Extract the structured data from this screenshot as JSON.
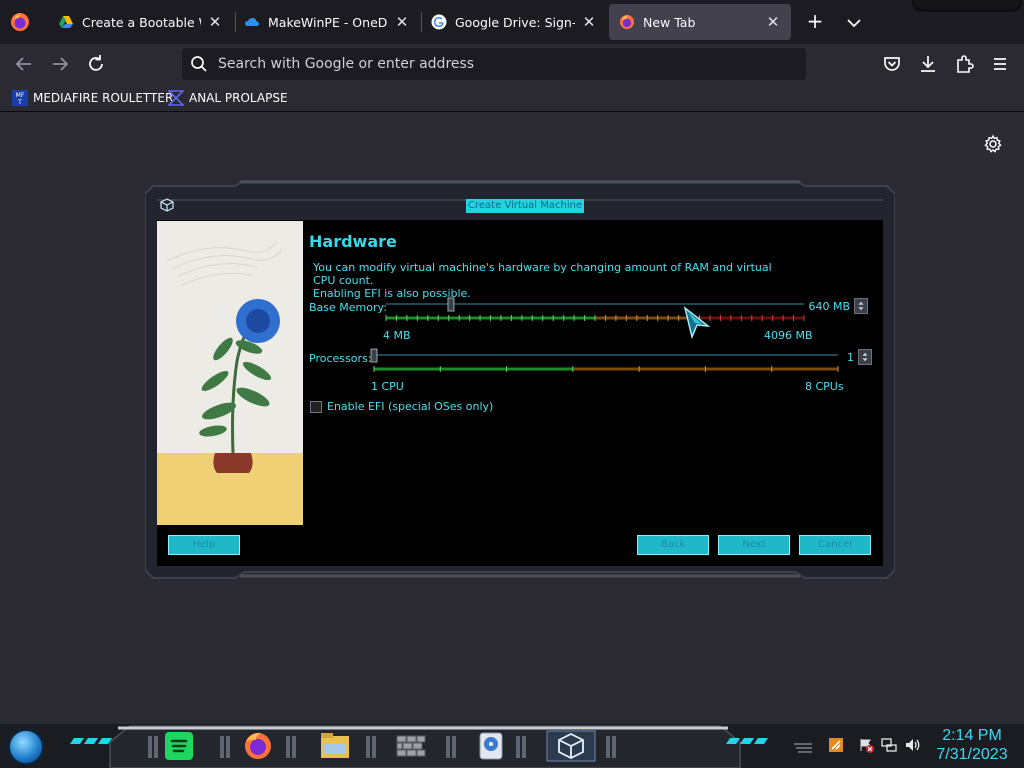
{
  "browser": {
    "tabs": [
      {
        "label": "Create a Bootable Wind",
        "icon": "google-drive-icon",
        "active": false
      },
      {
        "label": "MakeWinPE - OneDrive",
        "icon": "onedrive-icon",
        "active": false
      },
      {
        "label": "Google Drive: Sign-in",
        "icon": "google-icon",
        "active": false
      },
      {
        "label": "New Tab",
        "icon": "firefox-icon",
        "active": true
      }
    ],
    "tab_close_glyph": "✕",
    "new_tab_glyph": "+",
    "search_placeholder": "Search with Google or enter address",
    "bookmarks": [
      {
        "label": "MEDIAFIRE ROULETTER",
        "icon": "mft-icon"
      },
      {
        "label": "ANAL PROLAPSE",
        "icon": "bookmark-logo-icon"
      }
    ]
  },
  "dialog": {
    "title": "Create Virtual Machine",
    "heading": "Hardware",
    "description_line1": "You can modify virtual machine's hardware by changing amount of RAM and virtual CPU count.",
    "description_line2": "Enabling EFI is also possible.",
    "memory": {
      "label": "Base Memory:",
      "value": "640 MB",
      "min_label": "4 MB",
      "max_label": "4096 MB",
      "min": 4,
      "max": 4096,
      "current": 640
    },
    "processors": {
      "label": "Processors:",
      "value": "1",
      "min_label": "1 CPU",
      "max_label": "8 CPUs",
      "min": 1,
      "max": 8,
      "current": 1
    },
    "efi_label": "Enable EFI (special OSes only)",
    "efi_checked": false,
    "buttons": {
      "help": "Help",
      "back": "Back",
      "next": "Next",
      "cancel": "Cancel"
    }
  },
  "taskbar": {
    "apps": [
      "spotify-icon",
      "firefox-icon",
      "file-explorer-icon",
      "firewall-icon",
      "disk-utility-icon",
      "virtualbox-icon"
    ],
    "time": "2:14 PM",
    "date": "7/31/2023"
  },
  "colors": {
    "accent_cyan": "#35d9e8",
    "browser_bg": "#2b2a33",
    "tabbar_bg": "#1c1b22"
  }
}
